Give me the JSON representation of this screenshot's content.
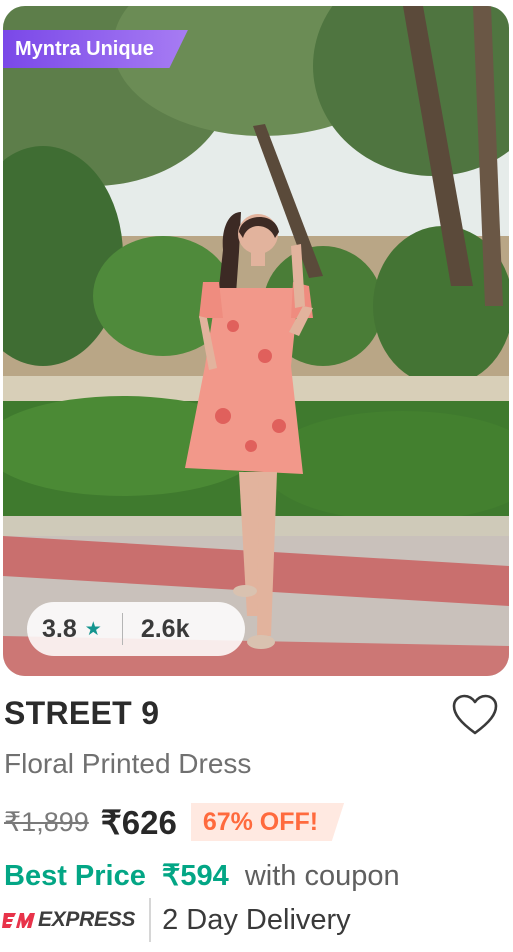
{
  "product": {
    "badge": "Myntra Unique",
    "rating": "3.8",
    "rating_count": "2.6k",
    "star_icon": "star-icon",
    "brand": "STREET 9",
    "title": "Floral Printed Dress",
    "mrp": "₹1,899",
    "price": "₹626",
    "discount": "67% OFF!",
    "best_price_label": "Best Price",
    "best_price_value": "₹594",
    "best_price_suffix": "with coupon",
    "express_label": "EXPRESS",
    "delivery": "2 Day Delivery"
  },
  "colors": {
    "badge": "#7a48e8",
    "rating_star": "#14958f",
    "best_price": "#03a685",
    "discount_text": "#ff6a3d",
    "express_brand": "#e8334a"
  }
}
